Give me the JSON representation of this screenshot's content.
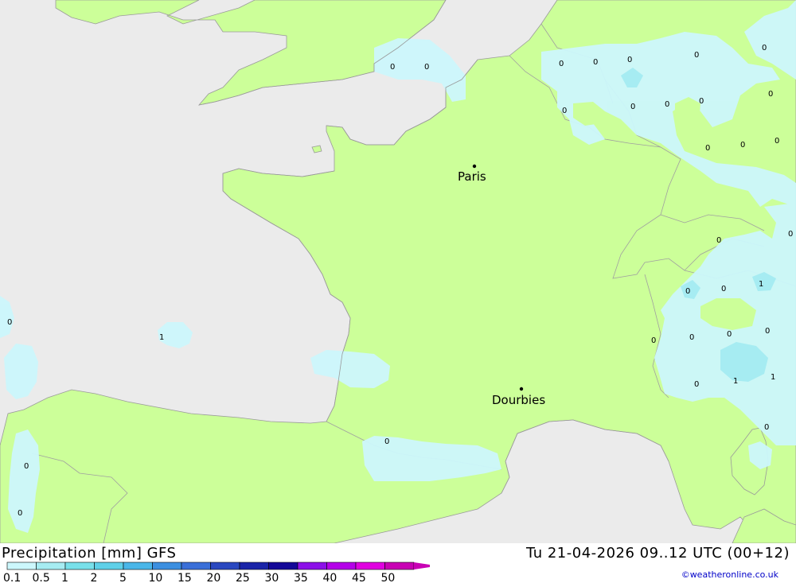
{
  "title": "Precipitation [mm] GFS",
  "valid_time": "Tu 21-04-2026 09..12 UTC (00+12)",
  "credit": "©weatheronline.co.uk",
  "colors": {
    "sea": "#ebebeb",
    "land": "#ccff99",
    "precip_0_1": "#ccf7fc",
    "precip_0_5": "#a6ecf2",
    "border": "#999999"
  },
  "legend": {
    "labels": [
      "0.1",
      "0.5",
      "1",
      "2",
      "5",
      "10",
      "15",
      "20",
      "25",
      "30",
      "35",
      "40",
      "45",
      "50"
    ],
    "colors": [
      "#ccf7fc",
      "#a6ecf2",
      "#78e0ea",
      "#5fd0e8",
      "#4ab6e8",
      "#3c8fe0",
      "#3a6fd8",
      "#2a48c0",
      "#1a24a8",
      "#140898",
      "#8c10e8",
      "#b400e8",
      "#e000e0",
      "#c800b4"
    ]
  },
  "cities": [
    {
      "name": "Paris"
    },
    {
      "name": "Dourbies"
    }
  ],
  "values": [
    "0",
    "0",
    "0",
    "0",
    "0",
    "0",
    "0",
    "0",
    "0",
    "0",
    "0",
    "0",
    "0",
    "0",
    "0",
    "0",
    "0",
    "0",
    "0",
    "1",
    "0",
    "1",
    "0",
    "0",
    "0",
    "0",
    "1",
    "1",
    "0",
    "0",
    "0",
    "0",
    "0"
  ]
}
